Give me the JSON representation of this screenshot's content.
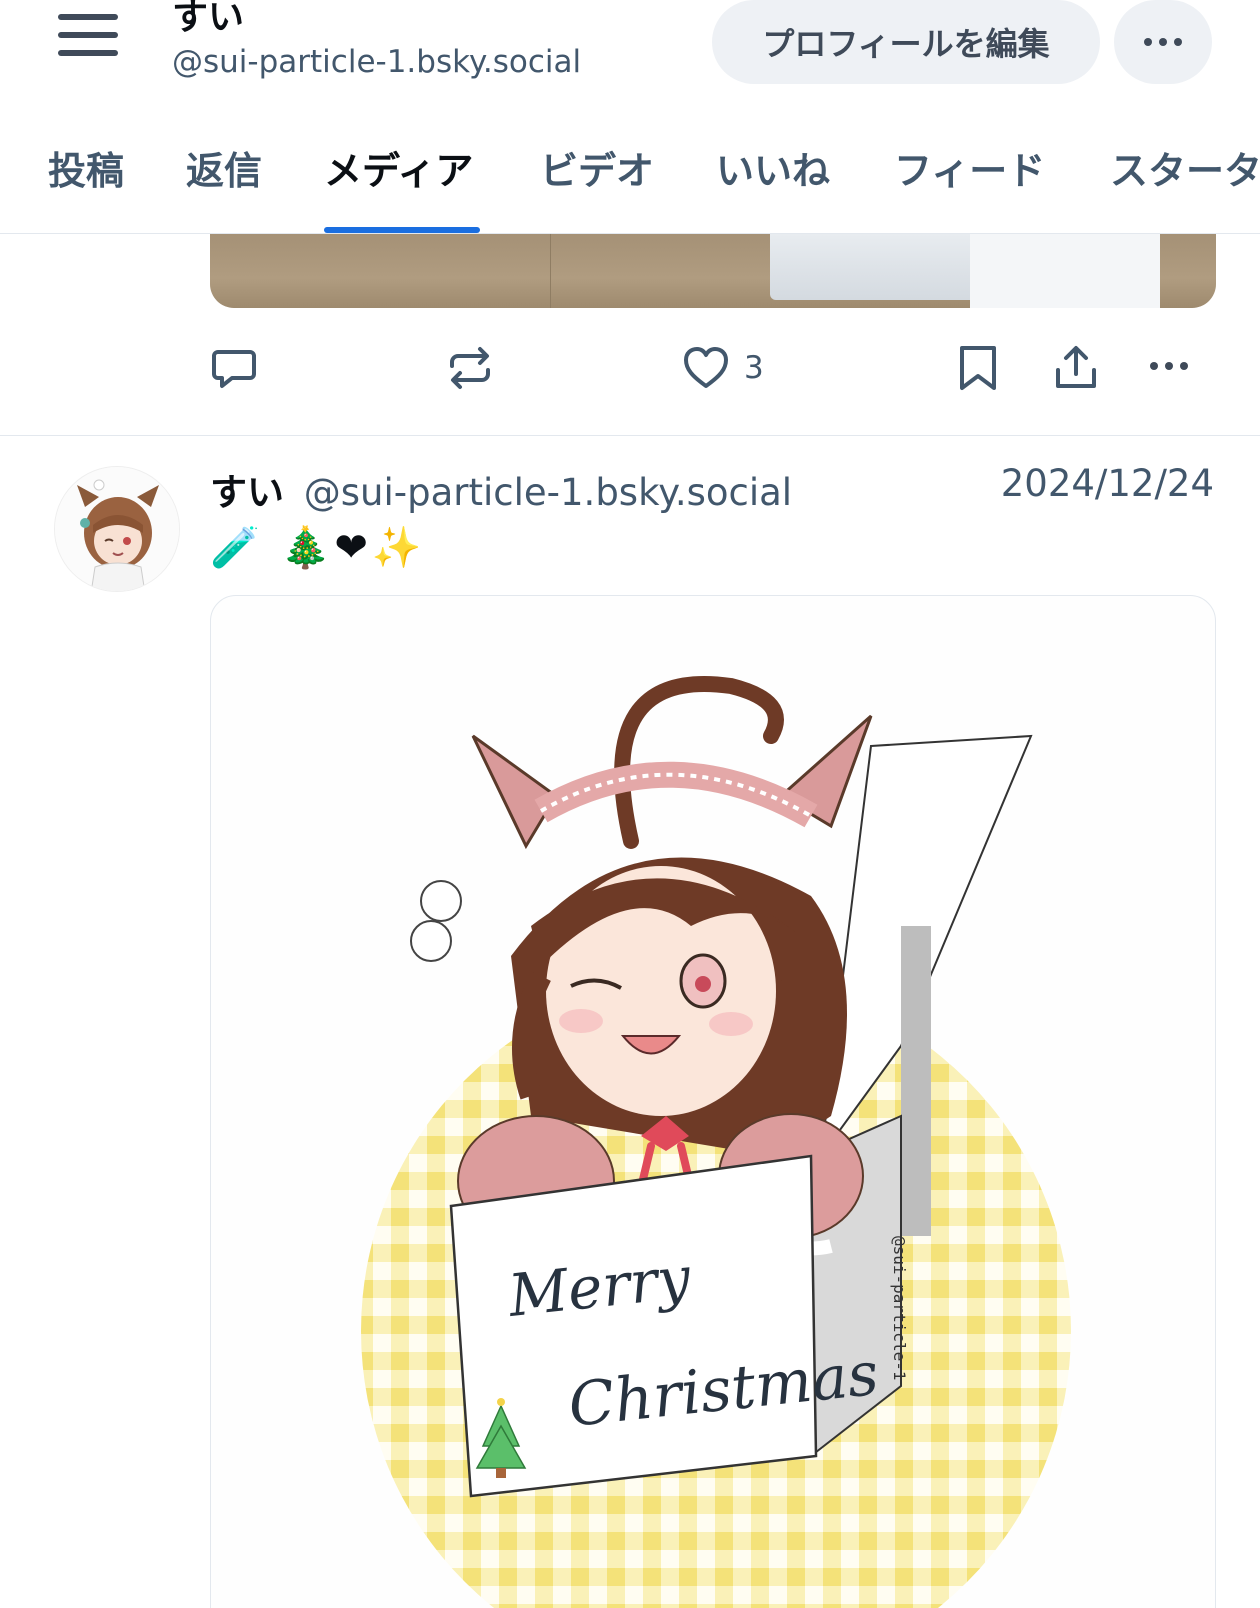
{
  "header": {
    "display_name": "すい",
    "handle": "@sui-particle-1.bsky.social",
    "edit_profile_label": "プロフィールを編集"
  },
  "tabs": [
    {
      "label": "投稿"
    },
    {
      "label": "返信"
    },
    {
      "label": "メディア",
      "active": true
    },
    {
      "label": "ビデオ"
    },
    {
      "label": "いいね"
    },
    {
      "label": "フィード"
    },
    {
      "label": "スターター"
    }
  ],
  "previous_post": {
    "like_count": "3"
  },
  "post": {
    "author_name": "すい",
    "author_handle": "@sui-particle-1.bsky.social",
    "date": "2024/12/24",
    "text": "🧪 🎄❤✨",
    "image": {
      "card_text_line1": "Merry",
      "card_text_line2": "Christmas",
      "signature": "@sui-particle-1"
    }
  },
  "colors": {
    "accent": "#1a6ee0",
    "muted_text": "#42576c",
    "button_bg": "#eef1f5"
  },
  "icons": [
    "hamburger-menu-icon",
    "more-dots-icon",
    "reply-icon",
    "repost-icon",
    "like-heart-icon",
    "bookmark-icon",
    "share-icon"
  ]
}
